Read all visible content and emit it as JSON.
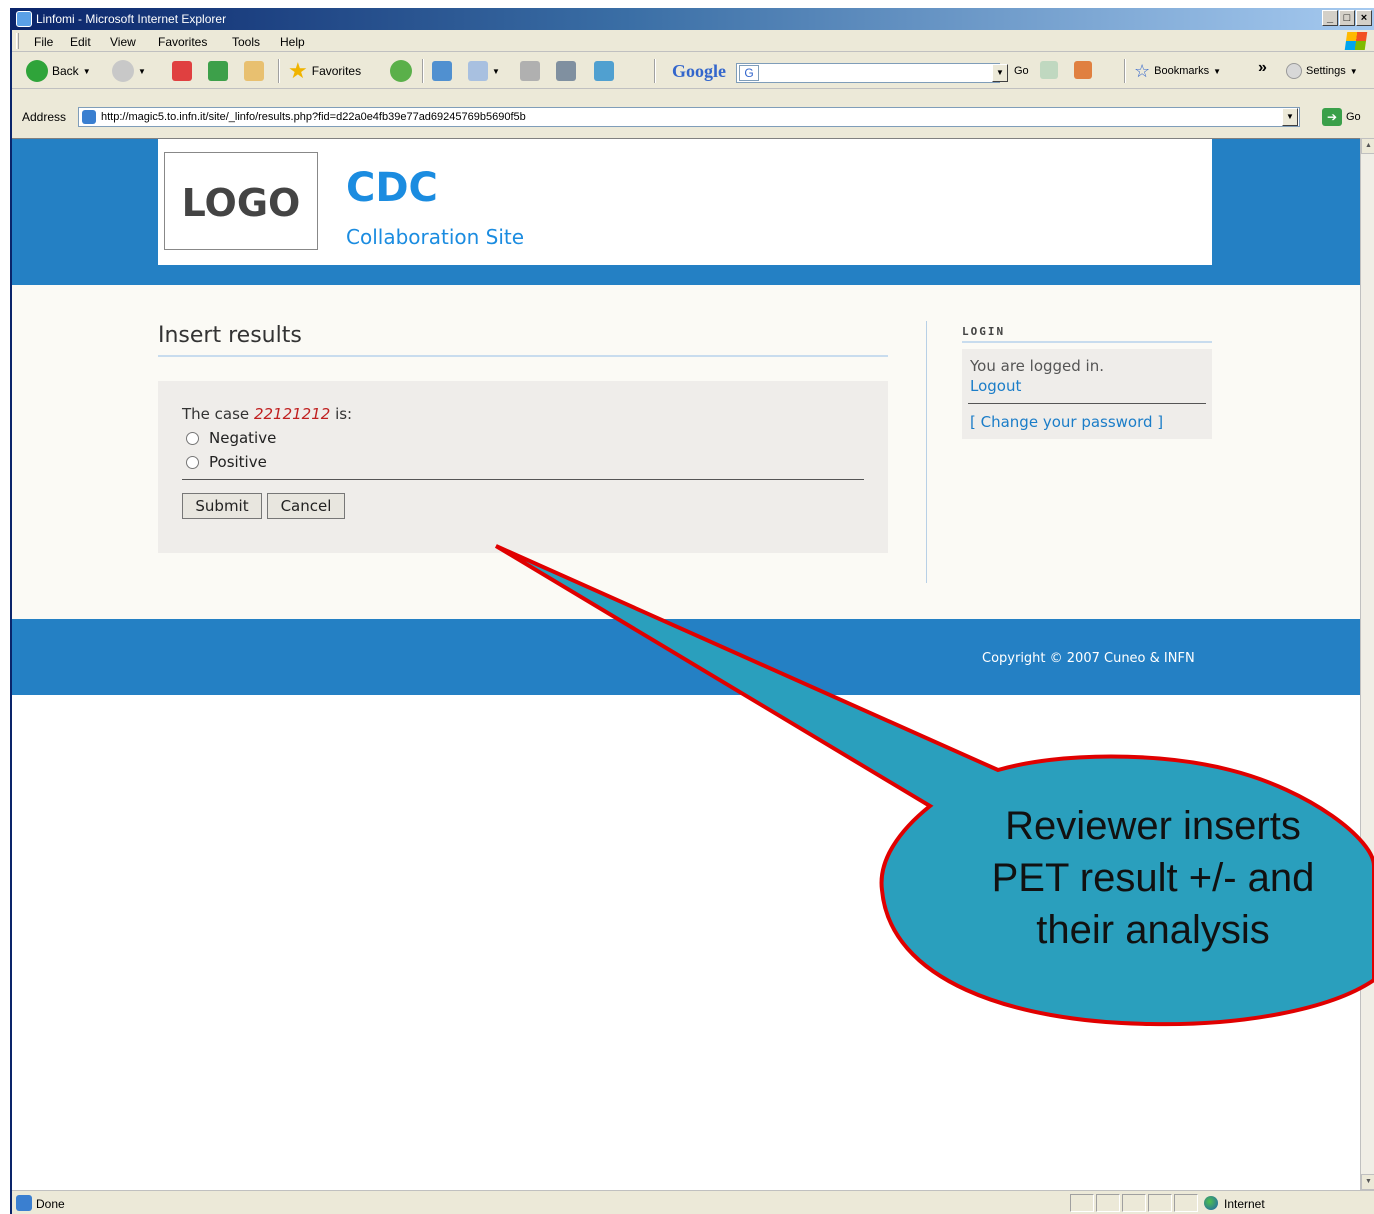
{
  "window": {
    "title": "Linfomi - Microsoft Internet Explorer"
  },
  "menu": [
    "File",
    "Edit",
    "View",
    "Favorites",
    "Tools",
    "Help"
  ],
  "toolbar": {
    "back_label": "Back",
    "favorites_label": "Favorites",
    "google_logo": "Google",
    "google_g": "G",
    "go_label": "Go",
    "bookmarks_label": "Bookmarks",
    "more_glyph": "»",
    "settings_label": "Settings"
  },
  "address": {
    "label": "Address",
    "url": "http://magic5.to.infn.it/site/_linfo/results.php?fid=d22a0e4fb39e77ad69245769b5690f5b",
    "go_label": "Go"
  },
  "site": {
    "logo_text": "LOGO",
    "title": "CDC",
    "subtitle": "Collaboration Site"
  },
  "main": {
    "page_title": "Insert results",
    "case_prefix": "The case",
    "case_id": "22121212",
    "case_suffix": "is:",
    "options": [
      "Negative",
      "Positive"
    ],
    "submit_label": "Submit",
    "cancel_label": "Cancel"
  },
  "login": {
    "title": "LOGIN",
    "status": "You are logged in.",
    "logout": "Logout",
    "change_password": "[ Change your password ]"
  },
  "footer": {
    "copyright": "Copyright © 2007 Cuneo & INFN"
  },
  "statusbar": {
    "status": "Done",
    "zone": "Internet"
  },
  "callout": {
    "lines": [
      "Reviewer inserts",
      "PET result +/- and",
      "their analysis"
    ],
    "fill_color": "#2a9fbd",
    "border_color": "#e00000"
  }
}
